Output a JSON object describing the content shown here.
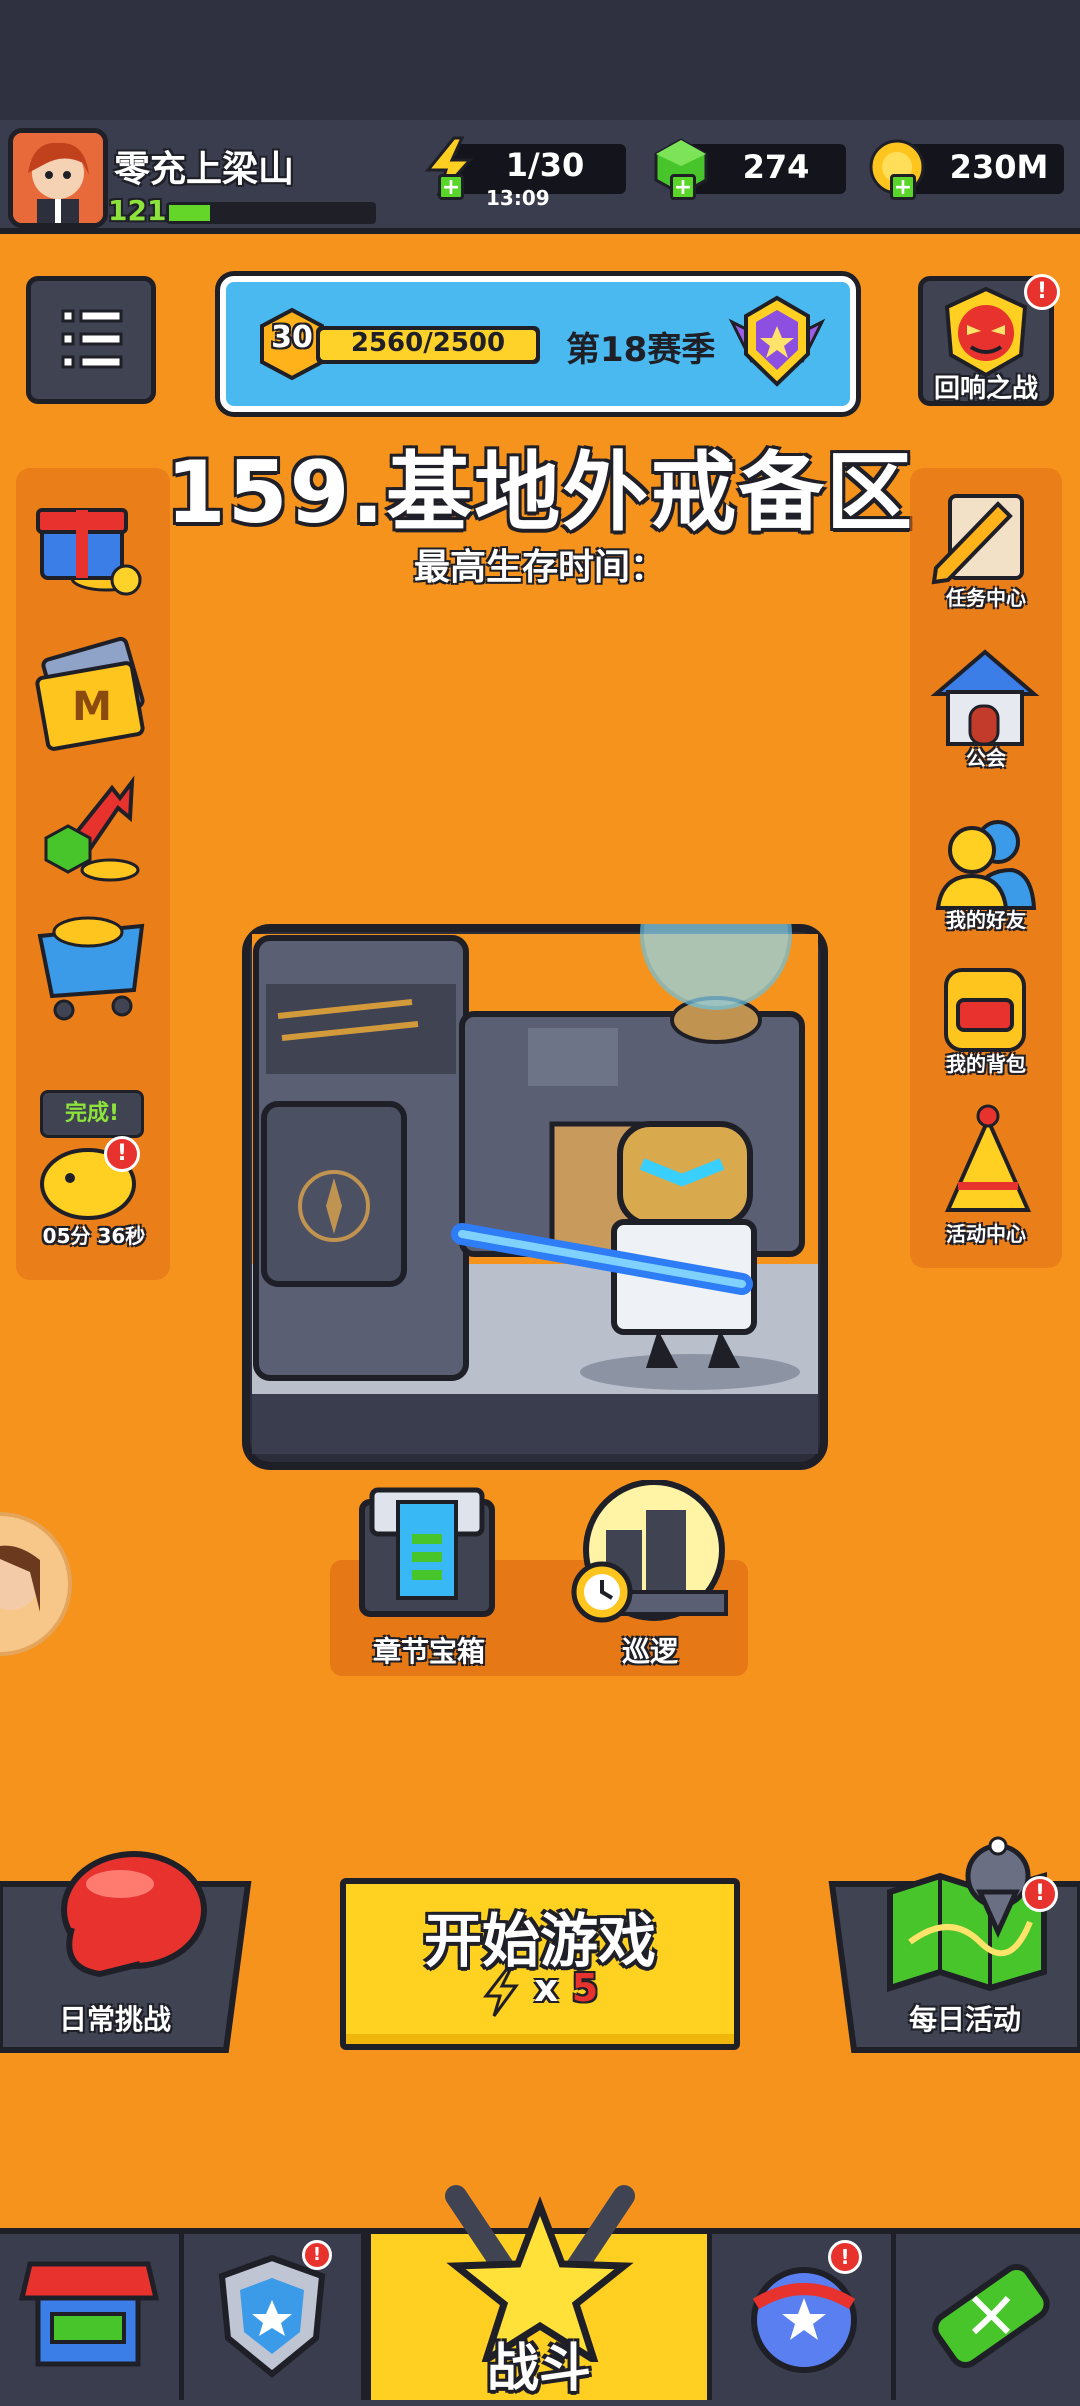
{
  "player": {
    "name": "零充上梁山",
    "level": "121",
    "xp_fraction": 0.2
  },
  "resources": {
    "energy": {
      "value": "1/30",
      "timer": "13:09",
      "icon": "lightning-icon"
    },
    "gems": {
      "value": "274",
      "icon": "green-gem-icon"
    },
    "coins": {
      "value": "230M",
      "icon": "gold-coin-icon"
    }
  },
  "season": {
    "level": "30",
    "xp": "2560/2500",
    "xp_fraction": 1.0,
    "label": "第18赛季"
  },
  "echo_battle": {
    "label": "回响之战",
    "badge": "!"
  },
  "stage": {
    "title": "159.基地外戒备区",
    "survival_label": "最高生存时间："
  },
  "left_side": {
    "items": [
      {
        "icon": "gift-box-icon"
      },
      {
        "icon": "monthly-card-icon",
        "letter": "M"
      },
      {
        "icon": "gem-growth-icon"
      },
      {
        "icon": "shop-cart-icon"
      }
    ],
    "piggy": {
      "bubble": "完成!",
      "timer": "05分 36秒",
      "badge": "!"
    }
  },
  "right_side": {
    "items": [
      {
        "label": "任务中心",
        "icon": "quest-scroll-icon"
      },
      {
        "label": "公会",
        "icon": "guild-house-icon"
      },
      {
        "label": "我的好友",
        "icon": "friends-icon"
      },
      {
        "label": "我的背包",
        "icon": "backpack-icon"
      },
      {
        "label": "活动中心",
        "icon": "event-party-icon"
      }
    ]
  },
  "chapter_chest": {
    "label": "章节宝箱"
  },
  "patrol": {
    "label": "巡逻"
  },
  "daily_challenge": {
    "label": "日常挑战"
  },
  "start_game": {
    "label": "开始游戏",
    "cost_prefix": "x",
    "cost": "5"
  },
  "daily_activity": {
    "label": "每日活动",
    "badge": "!"
  },
  "nav": {
    "battle_label": "战斗",
    "equipment_badge": "!",
    "talent_badge": "!"
  },
  "colors": {
    "background": "#f6931d",
    "accent_yellow": "#ffd221",
    "dark": "#1f1f28",
    "badge_red": "#e8322e"
  }
}
